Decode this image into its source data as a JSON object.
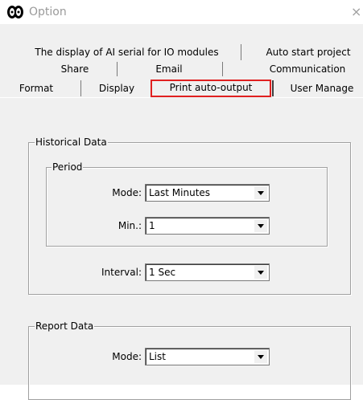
{
  "window": {
    "title": "Option",
    "icon": "app-logo-icon",
    "close_glyph": "×"
  },
  "tabs": {
    "row1": [
      {
        "label": "The display of AI serial for IO modules"
      },
      {
        "label": "Auto start project"
      }
    ],
    "row2": [
      {
        "label": "Share"
      },
      {
        "label": "Email"
      },
      {
        "label": "Communication"
      }
    ],
    "row3": [
      {
        "label": "Format"
      },
      {
        "label": "Display"
      },
      {
        "label": "Print auto-output"
      },
      {
        "label": "User Manage"
      }
    ],
    "active": "Print auto-output",
    "highlight_color": "#e02020"
  },
  "historical": {
    "title": "Historical Data",
    "period": {
      "title": "Period",
      "mode_label": "Mode:",
      "mode_value": "Last Minutes",
      "min_label": "Min.:",
      "min_value": "1"
    },
    "interval_label": "Interval:",
    "interval_value": "1 Sec"
  },
  "report": {
    "title": "Report Data",
    "mode_label": "Mode:",
    "mode_value": "List"
  }
}
